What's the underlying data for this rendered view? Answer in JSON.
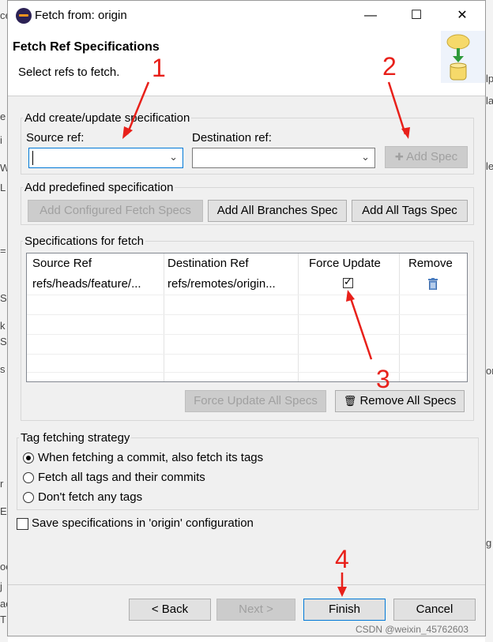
{
  "window": {
    "title": "Fetch from: origin",
    "minimize": "—",
    "maximize": "☐",
    "close": "✕"
  },
  "header": {
    "title": "Fetch Ref Specifications",
    "subtitle": "Select refs to fetch."
  },
  "create_group": {
    "legend": "Add create/update specification",
    "source_label": "Source ref:",
    "source_value": "",
    "dest_label": "Destination ref:",
    "dest_value": "",
    "add_spec": "Add Spec"
  },
  "predefined_group": {
    "legend": "Add predefined specification",
    "configured": "Add Configured Fetch Specs",
    "all_branches": "Add All Branches Spec",
    "all_tags": "Add All Tags Spec"
  },
  "specs_group": {
    "legend": "Specifications for fetch",
    "columns": [
      "Source Ref",
      "Destination Ref",
      "Force Update",
      "Remove"
    ],
    "rows": [
      {
        "source": "refs/heads/feature/...",
        "dest": "refs/remotes/origin...",
        "force": true
      }
    ],
    "force_all": "Force Update All Specs",
    "remove_all": "Remove All Specs"
  },
  "tag_group": {
    "legend": "Tag fetching strategy",
    "options": [
      "When fetching a commit, also fetch its tags",
      "Fetch all tags and their commits",
      "Don't fetch any tags"
    ],
    "selected": 0
  },
  "save_spec": {
    "label": "Save specifications in 'origin' configuration",
    "checked": false
  },
  "footer": {
    "back": "< Back",
    "next": "Next >",
    "finish": "Finish",
    "cancel": "Cancel"
  },
  "annotations": [
    "1",
    "2",
    "3",
    "4"
  ],
  "watermark": "CSDN @weixin_45762603",
  "background": {
    "left": [
      "ce",
      "e",
      "i",
      "W",
      "L",
      "=",
      "S",
      "k",
      "S",
      "s",
      "r",
      "E",
      "oe",
      "j",
      "ac",
      "T"
    ],
    "right": [
      "lp",
      "la",
      "le",
      "or",
      "g"
    ]
  },
  "colors": {
    "annotation": "#e8201a",
    "focus": "#0078d7",
    "dialog_bg": "#f0f0f0"
  }
}
